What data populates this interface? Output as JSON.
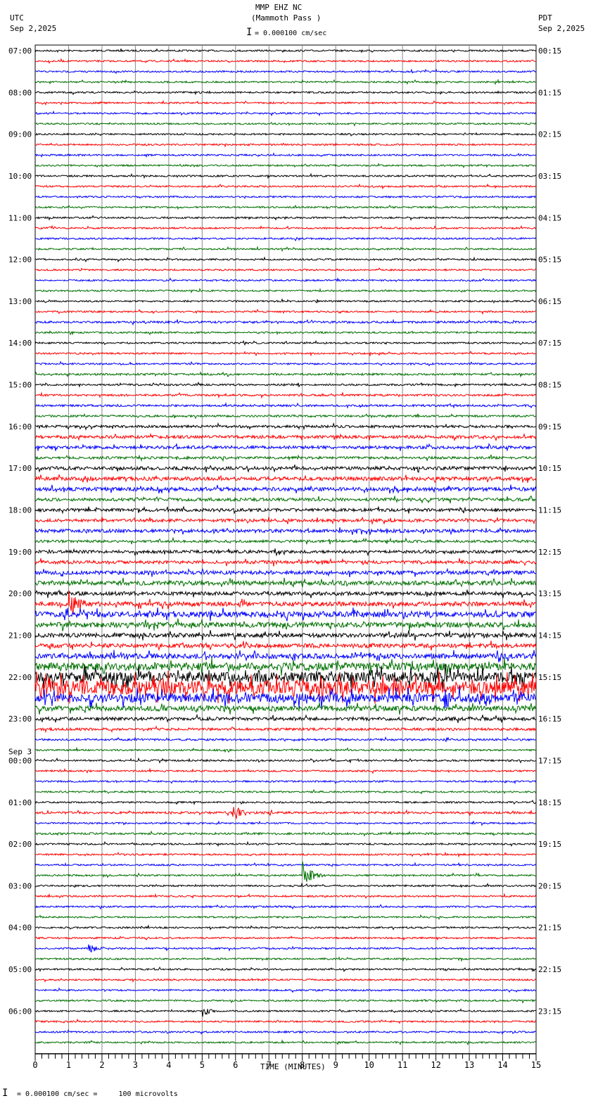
{
  "header": {
    "title": "MMP EHZ NC",
    "subtitle": "(Mammoth Pass )",
    "left_tz": "UTC",
    "left_date": "Sep 2,2025",
    "right_tz": "PDT",
    "right_date": "Sep 2,2025",
    "scale": "= 0.000100 cm/sec"
  },
  "footer": {
    "scale": "= 0.000100 cm/sec =     100 microvolts"
  },
  "chart_data": {
    "type": "line",
    "title": "MMP EHZ NC (Mammoth Pass )",
    "xlabel": "TIME (MINUTES)",
    "xlim": [
      0,
      15
    ],
    "x_ticks": [
      "0",
      "1",
      "2",
      "3",
      "4",
      "5",
      "6",
      "7",
      "8",
      "9",
      "10",
      "11",
      "12",
      "13",
      "14",
      "15"
    ],
    "trace_colors": [
      "#000000",
      "#ff0000",
      "#0000ff",
      "#007000"
    ],
    "traces_per_hour": 4,
    "date_change_label": "Sep 3",
    "left_labels": [
      "07:00",
      "08:00",
      "09:00",
      "10:00",
      "11:00",
      "12:00",
      "13:00",
      "14:00",
      "15:00",
      "16:00",
      "17:00",
      "18:00",
      "19:00",
      "20:00",
      "21:00",
      "22:00",
      "23:00",
      "00:00",
      "01:00",
      "02:00",
      "03:00",
      "04:00",
      "05:00",
      "06:00"
    ],
    "right_labels": [
      "00:15",
      "01:15",
      "02:15",
      "03:15",
      "04:15",
      "05:15",
      "06:15",
      "07:15",
      "08:15",
      "09:15",
      "10:15",
      "11:15",
      "12:15",
      "13:15",
      "14:15",
      "15:15",
      "16:15",
      "17:15",
      "18:15",
      "19:15",
      "20:15",
      "21:15",
      "22:15",
      "23:15"
    ],
    "noise_level": [
      1,
      1,
      1,
      1,
      1,
      1,
      1,
      1,
      1,
      1,
      1,
      1,
      1,
      1,
      1,
      1,
      1,
      1,
      1,
      1,
      1,
      1,
      1,
      1,
      1,
      1,
      1.3,
      1,
      1,
      1,
      1,
      1.2,
      1.1,
      1.2,
      1.2,
      1.2,
      1.5,
      1.8,
      1.8,
      1.5,
      2,
      2.2,
      2.2,
      1.8,
      1.8,
      1.8,
      2,
      1.5,
      1.8,
      2,
      2.2,
      2.5,
      2.2,
      2.5,
      3.2,
      3,
      2.5,
      2.5,
      3,
      4.5,
      6,
      8,
      5,
      3,
      2,
      1.5,
      1.2,
      1,
      1,
      1,
      1,
      1,
      1,
      1.3,
      1,
      1.2,
      1,
      1,
      1,
      1,
      1,
      1,
      1,
      1,
      1,
      1,
      1,
      1,
      1,
      1,
      1,
      1,
      1,
      1,
      1,
      1
    ],
    "events": [
      {
        "trace": 17,
        "minute": 0.3,
        "amplitude": 5
      },
      {
        "trace": 53,
        "minute": 1.0,
        "amplitude": 25
      },
      {
        "trace": 61,
        "minute": 3.3,
        "amplitude": 12
      },
      {
        "trace": 62,
        "minute": 12.2,
        "amplitude": 14
      },
      {
        "trace": 73,
        "minute": 5.9,
        "amplitude": 14
      },
      {
        "trace": 79,
        "minute": 8.0,
        "amplitude": 20
      },
      {
        "trace": 92,
        "minute": 5.0,
        "amplitude": 8
      },
      {
        "trace": 86,
        "minute": 1.6,
        "amplitude": 8
      }
    ]
  }
}
